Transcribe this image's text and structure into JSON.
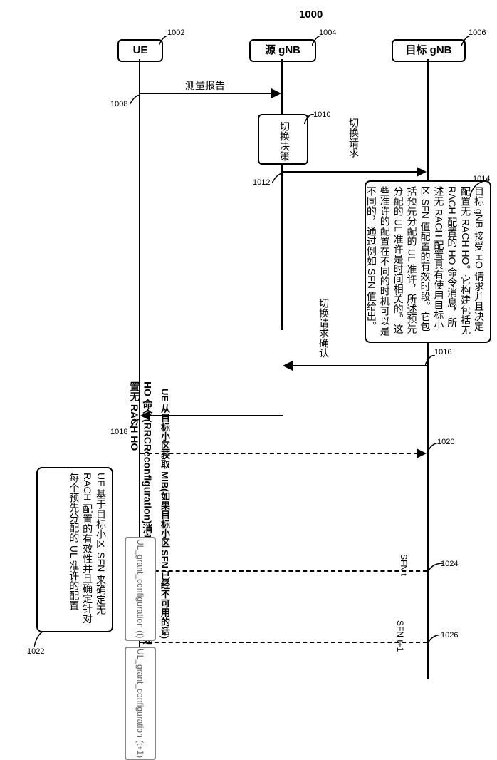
{
  "diagram": {
    "id": "1000",
    "entities": {
      "ue": {
        "label": "UE",
        "ref": "1002"
      },
      "source_gnb": {
        "label": "源 gNB",
        "ref": "1004"
      },
      "target_gnb": {
        "label": "目标 gNB",
        "ref": "1006"
      }
    },
    "messages": {
      "measurement_report": {
        "label": "测量报告",
        "ref": "1008"
      },
      "handover_decision": {
        "label": "切换决策",
        "ref": "1010"
      },
      "handover_request": {
        "label": "切换请求",
        "ref": "1012"
      },
      "handover_request_ack": {
        "label": "切换请求确认",
        "ref": "1016"
      },
      "ho_command_line1": "HO 命令(RRCReconfiguration)消息，包含 HO 命令，所述 HO 命令配置无 RACH HO",
      "mib_read": {
        "label": "UE 从目标小区获取 MIB(如果目标小区 SFN 已经不可用的话)",
        "ref": "1020"
      }
    },
    "notes": {
      "target_note": {
        "ref": "1014",
        "text": "目标 gNB 接受 HO 请求并且决定配置无 RACH HO。它构建包括无 RACH 配置的 HO 命令消息，所述无 RACH 配置具有使用目标小区 SFN 值配置的有效时段。它包括预先分配的 UL 准许，所述预先分配的 UL 准许是时间相关的。这些准许的配置在不同的时机可以是不同的，通过例如 SFN 值给出。"
      },
      "ue_note": {
        "ref": "1022",
        "text": "UE 基于目标小区 SFN 来确定无 RACH 配置的有效性并且确定针对每个预先分配的 UL 准许的配置",
        "ref2": "1018"
      }
    },
    "grants": {
      "grant_t": {
        "label": "UL_grant_configuration (t)",
        "sfn": "SFN t",
        "ref": "1024"
      },
      "grant_t1": {
        "label": "UL_grant_configuration (t+1)",
        "sfn": "SFN t+1",
        "ref": "1026"
      }
    }
  }
}
